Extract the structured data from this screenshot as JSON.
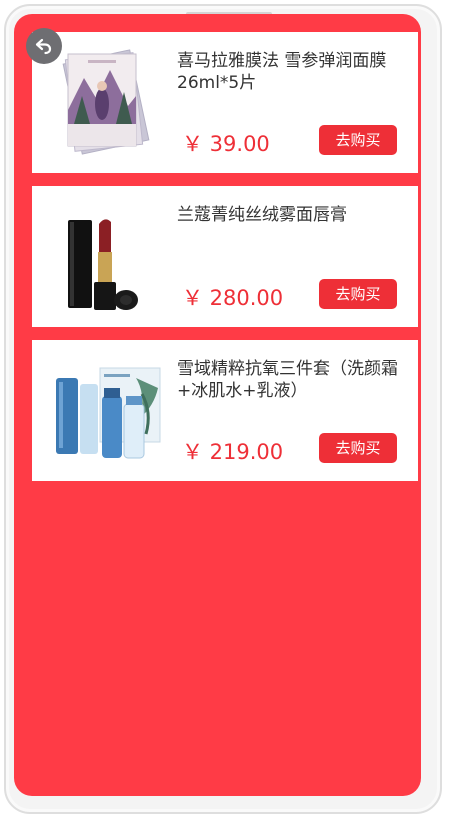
{
  "products": [
    {
      "title": "喜马拉雅膜法 雪参弹润面膜26ml*5片",
      "price": "￥ 39.00",
      "buy_label": "去购买",
      "image": "face-mask-product-image"
    },
    {
      "title": "兰蔻菁纯丝绒雾面唇膏",
      "price": "￥ 280.00",
      "buy_label": "去购买",
      "image": "lipstick-product-image"
    },
    {
      "title": "雪域精粹抗氧三件套（洗颜霜+冰肌水+乳液）",
      "price": "￥ 219.00",
      "buy_label": "去购买",
      "image": "skincare-set-product-image"
    }
  ],
  "colors": {
    "background": "#ff3b46",
    "accent": "#ee2f37",
    "card": "#ffffff"
  },
  "icons": {
    "back": "back-arrow-icon"
  }
}
